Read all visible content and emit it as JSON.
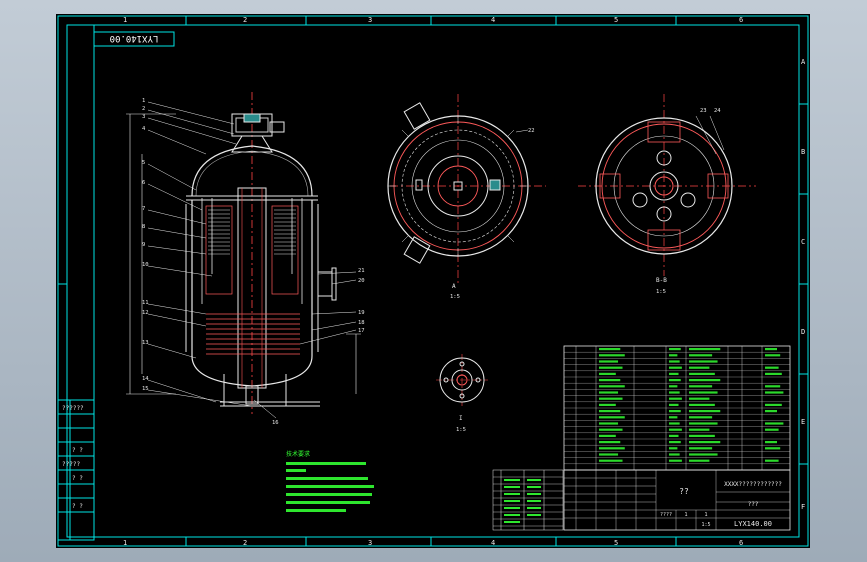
{
  "drawing_number": "LYX140.00",
  "border_columns": [
    "1",
    "2",
    "3",
    "4",
    "5",
    "6"
  ],
  "border_rows": [
    "A",
    "B",
    "C",
    "D",
    "E",
    "F"
  ],
  "views": {
    "section_a": "A",
    "section_b": "B-B",
    "detail_i": "I",
    "section_a_scale": "1:5",
    "section_b_scale": "1:5",
    "detail_scale": "1:5"
  },
  "side_stamps": [
    "??????",
    "? ?",
    "?????",
    "? ?",
    "? ?"
  ],
  "leader_labels_left": [
    "1",
    "2",
    "3",
    "4",
    "5",
    "6",
    "7",
    "8",
    "9",
    "10",
    "11",
    "12",
    "13",
    "14",
    "15"
  ],
  "leader_labels_right": [
    "16",
    "17",
    "18",
    "19",
    "20",
    "21"
  ],
  "leader_labels_sections": [
    "22",
    "23",
    "24"
  ],
  "title_block": {
    "name_placeholder": "??",
    "company": "XXXX????????????",
    "small_label": "???",
    "drawing_no": "LYX140.00",
    "scale_cell": "1:5",
    "sheet_cells": [
      "????",
      "1",
      "1"
    ]
  },
  "notes_heading": "技术要求"
}
